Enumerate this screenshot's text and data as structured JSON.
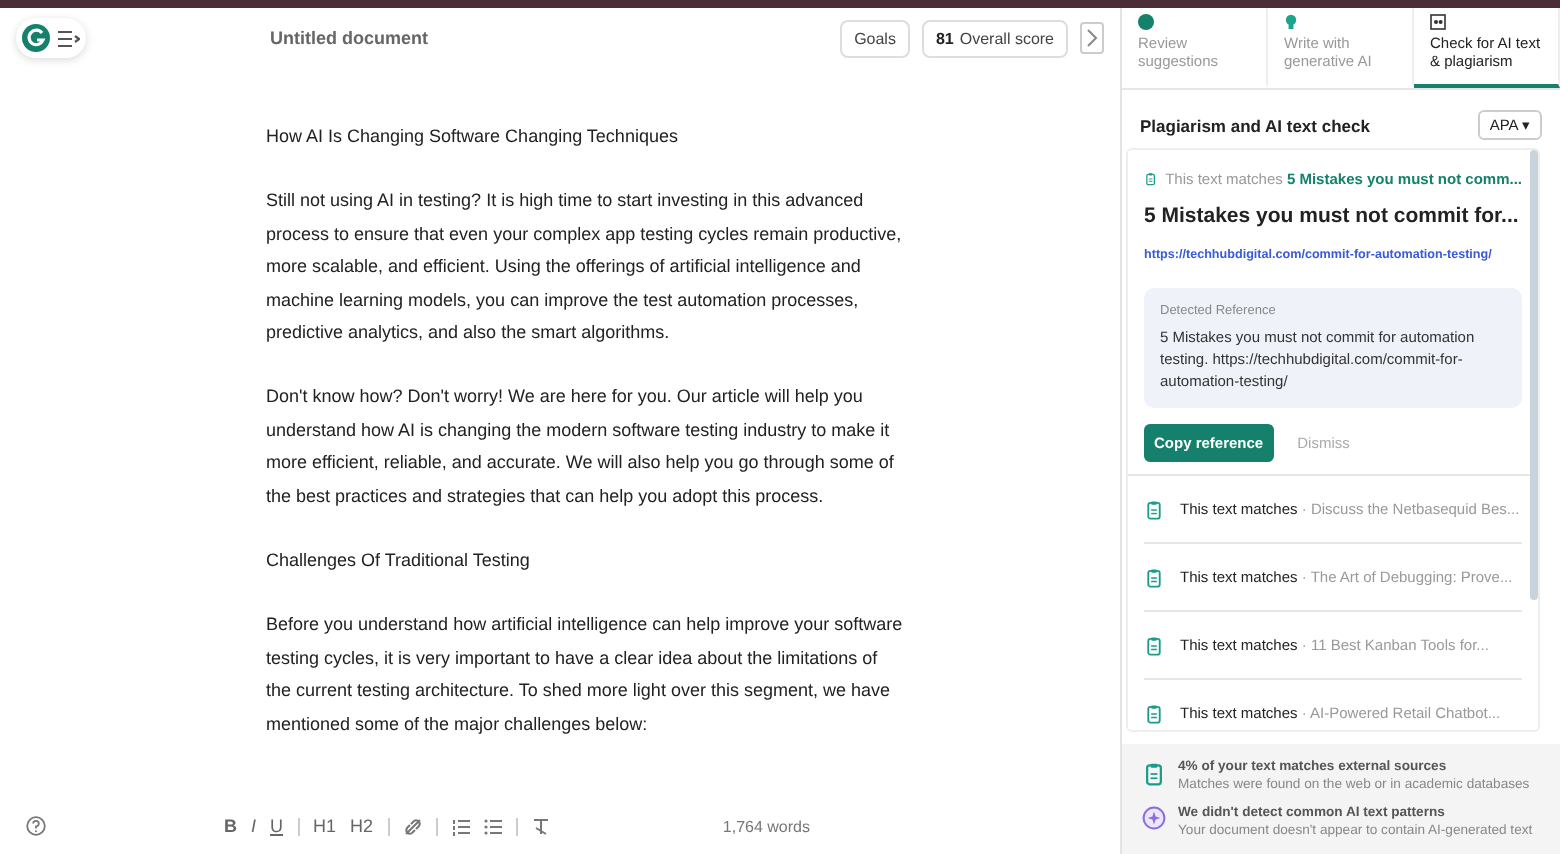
{
  "header": {
    "title": "Untitled document",
    "goals": "Goals",
    "score": "81",
    "score_label": "Overall score"
  },
  "document": [
    {
      "text": "How AI Is Changing Software Changing Techniques"
    },
    {
      "text": "Still not using AI in testing? It is high time to start investing in this advanced process to ensure that even your complex app testing cycles remain productive, more scalable, and efficient. Using the offerings of artificial intelligence and machine learning models, you can improve the test automation processes, predictive analytics, and also the smart algorithms."
    },
    {
      "text": "Don't know how? Don't worry! We are here for you. Our article will help you understand how AI is changing the modern software testing industry to make it more efficient, reliable, and accurate. We will also help you go through some of the best practices and strategies that can help you adopt this process."
    },
    {
      "text": "Challenges Of Traditional Testing"
    },
    {
      "text": "Before you understand how artificial intelligence can help improve your software testing cycles, it is very important to have a clear idea about the limitations of the current testing architecture. To shed more light over this segment, we have mentioned some of the major challenges below:"
    }
  ],
  "toolbar": {
    "format_buttons": [
      "B",
      "I",
      "U",
      "H1",
      "H2"
    ],
    "word_count": "1,764 words"
  },
  "panel": {
    "tabs": [
      {
        "label": "Review suggestions",
        "selected": false
      },
      {
        "label": "Write with generative AI",
        "selected": false
      },
      {
        "label": "Check for AI text & plagiarism",
        "selected": true
      }
    ],
    "heading": "Plagiarism and AI text check",
    "style": "APA",
    "style_caret": "▾",
    "match": {
      "prefix": "This text matches",
      "source": "5 Mistakes you must not comm...",
      "title": "5 Mistakes you must not commit for...",
      "url": "https://techhubdigital.com/commit-for-automation-testing/",
      "reference_label": "Detected Reference",
      "reference": "5 Mistakes you must not commit for automation testing. https://techhubdigital.com/commit-for-automation-testing/",
      "copy": "Copy reference",
      "dismiss": "Dismiss"
    },
    "matches": [
      {
        "prefix": "This text matches",
        "source": "· Discuss the Netbasequid Bes..."
      },
      {
        "prefix": "This text matches",
        "source": "· The Art of Debugging: Prove..."
      },
      {
        "prefix": "This text matches",
        "source": "· 11 Best Kanban Tools for..."
      },
      {
        "prefix": "This text matches",
        "source": "· AI-Powered Retail Chatbot..."
      }
    ],
    "summary": [
      {
        "kind": "plagiarism",
        "title": "4% of your text matches external sources",
        "detail": "Matches were found on the web or in academic databases"
      },
      {
        "kind": "ai",
        "title": "We didn't detect common AI text patterns",
        "detail": "Your document doesn't appear to contain AI-generated text"
      }
    ]
  }
}
